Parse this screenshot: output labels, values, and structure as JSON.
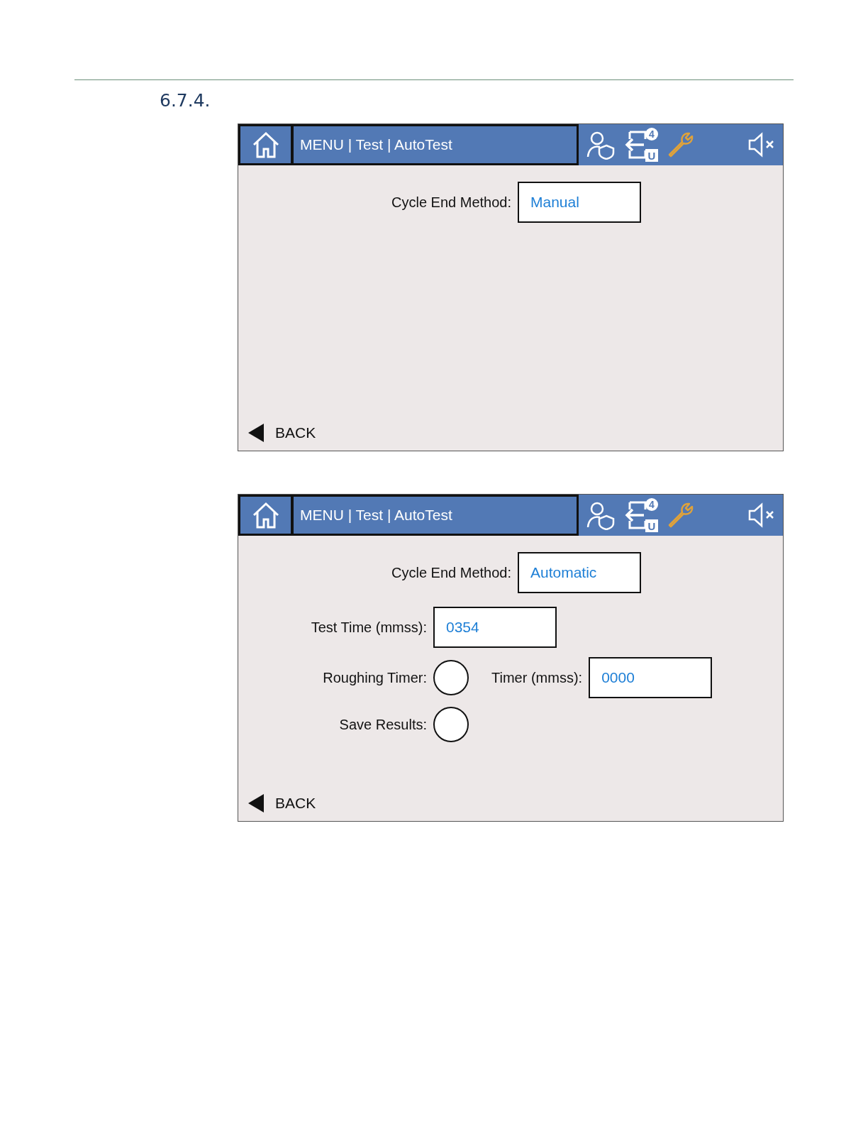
{
  "section": {
    "number": "6.7.4."
  },
  "screens": [
    {
      "breadcrumb": "MENU | Test | AutoTest",
      "badge": "4",
      "drive_letter": "U",
      "rows": [
        {
          "kind": "select",
          "label": "Cycle End Method:",
          "value": "Manual"
        }
      ],
      "back": "BACK"
    },
    {
      "breadcrumb": "MENU | Test | AutoTest",
      "badge": "4",
      "drive_letter": "U",
      "rows": [
        {
          "kind": "select",
          "label": "Cycle End Method:",
          "value": "Automatic"
        },
        {
          "kind": "field",
          "label": "Test Time (mmss):",
          "value": "0354"
        },
        {
          "kind": "toggle",
          "label": "Roughing Timer:",
          "on": false,
          "extra_label": "Timer (mmss):",
          "extra_value": "0000"
        },
        {
          "kind": "toggle",
          "label": "Save Results:",
          "on": false
        }
      ],
      "back": "BACK"
    }
  ]
}
